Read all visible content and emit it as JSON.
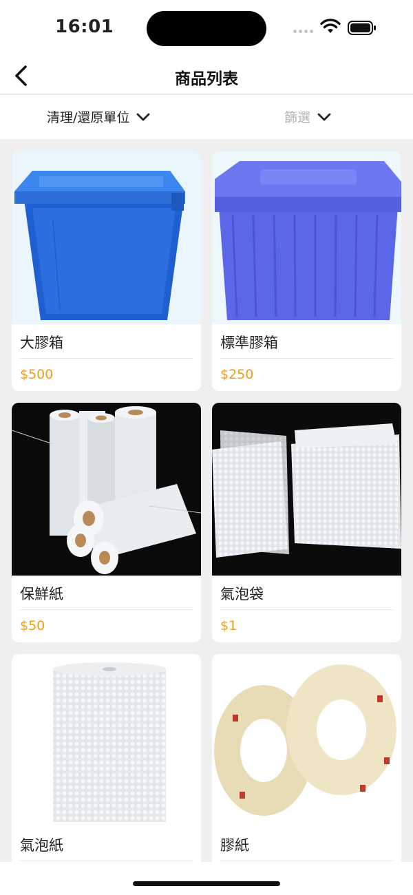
{
  "status_bar": {
    "time": "16:01"
  },
  "nav": {
    "title": "商品列表"
  },
  "filters": {
    "unit_label": "清理/還原單位",
    "filter_label": "篩選"
  },
  "products": [
    {
      "name": "大膠箱",
      "price": "$500",
      "image": "blue-storage-crate"
    },
    {
      "name": "標準膠箱",
      "price": "$250",
      "image": "purple-storage-crate"
    },
    {
      "name": "保鮮紙",
      "price": "$50",
      "image": "stretch-film-rolls"
    },
    {
      "name": "氣泡袋",
      "price": "$1",
      "image": "bubble-bags"
    },
    {
      "name": "氣泡紙",
      "price": "",
      "image": "bubble-wrap-roll"
    },
    {
      "name": "膠紙",
      "price": "",
      "image": "packing-tape-rolls"
    }
  ],
  "colors": {
    "accent_price": "#f39c12",
    "background": "#efefef"
  }
}
